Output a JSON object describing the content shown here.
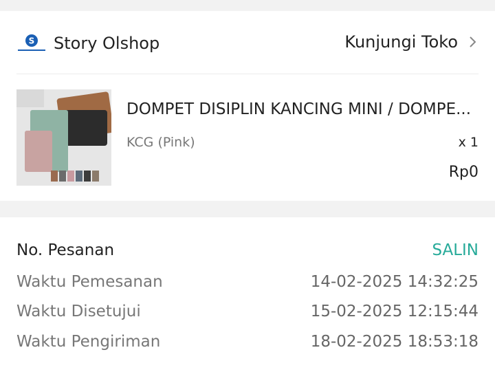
{
  "shop": {
    "name": "Story Olshop",
    "visit_label": "Kunjungi Toko",
    "logo_letter": "S"
  },
  "product": {
    "title": "DOMPET DISIPLIN KANCING MINI / DOMPE...",
    "variant": "KCG (Pink)",
    "quantity": "x 1",
    "price": "Rp0"
  },
  "order": {
    "number_label": "No. Pesanan",
    "copy_label": "SALIN",
    "rows": [
      {
        "label": "Waktu Pemesanan",
        "value": "14-02-2025 14:32:25"
      },
      {
        "label": "Waktu Disetujui",
        "value": "15-02-2025 12:15:44"
      },
      {
        "label": "Waktu Pengiriman",
        "value": "18-02-2025 18:53:18"
      }
    ]
  },
  "colors": {
    "accent": "#26aa99",
    "logo_blue": "#1a5fb4"
  }
}
